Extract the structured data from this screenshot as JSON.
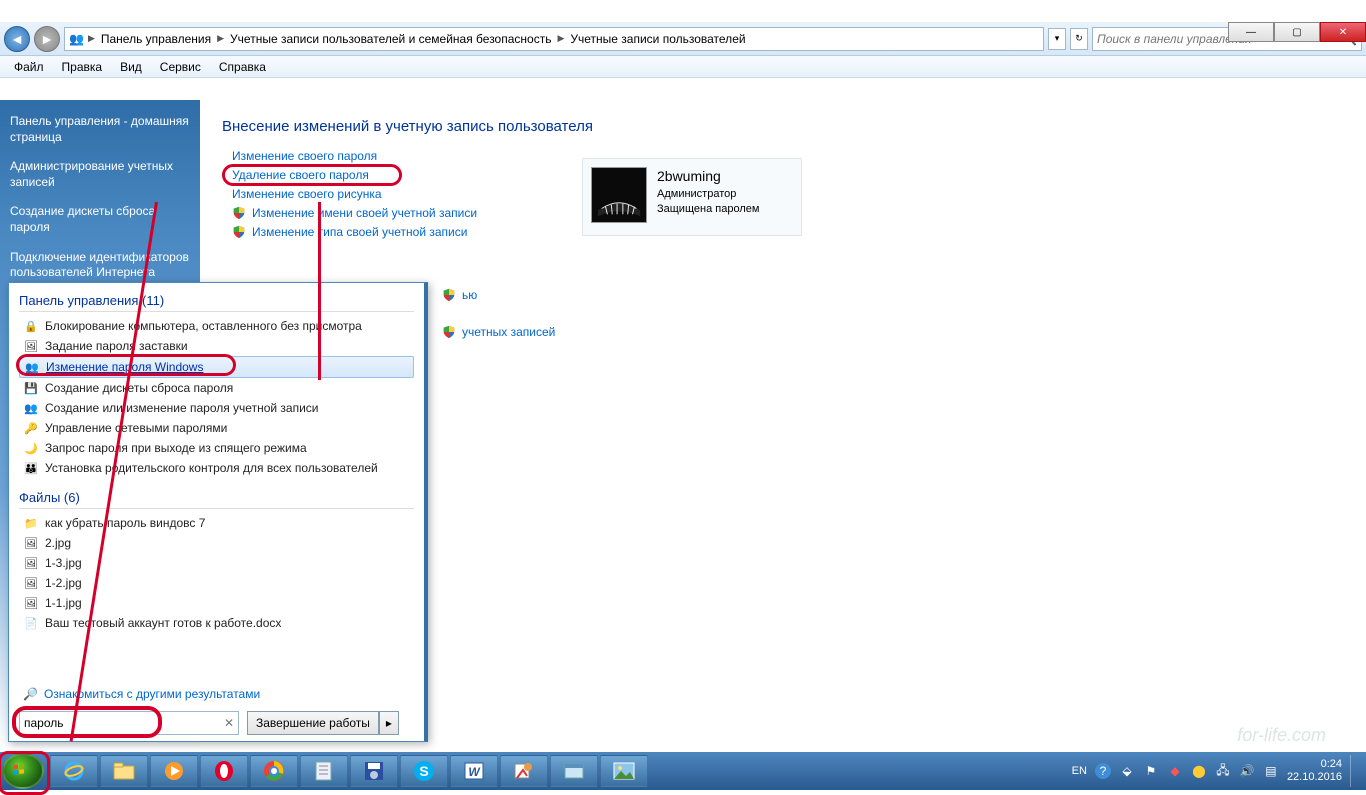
{
  "window": {
    "breadcrumb": [
      "Панель управления",
      "Учетные записи пользователей и семейная безопасность",
      "Учетные записи пользователей"
    ],
    "search_placeholder": "Поиск в панели управления"
  },
  "menubar": [
    "Файл",
    "Правка",
    "Вид",
    "Сервис",
    "Справка"
  ],
  "sidebar": {
    "home": "Панель управления - домашняя страница",
    "links": [
      "Администрирование учетных записей",
      "Создание дискеты сброса пароля",
      "Подключение идентификаторов пользователей Интернета"
    ]
  },
  "main": {
    "title": "Внесение изменений в учетную запись пользователя",
    "links": [
      {
        "text": "Изменение своего пароля",
        "shield": false
      },
      {
        "text": "Удаление своего пароля",
        "shield": false,
        "highlight": true
      },
      {
        "text": "Изменение своего рисунка",
        "shield": false
      },
      {
        "text": "Изменение имени своей учетной записи",
        "shield": true
      },
      {
        "text": "Изменение типа своей учетной записи",
        "shield": true
      },
      {
        "text": "ью",
        "shield": true,
        "partial": true
      },
      {
        "text": "учетных записей",
        "shield": true,
        "partial": true
      }
    ]
  },
  "user": {
    "name": "2bwuming",
    "role": "Администратор",
    "status": "Защищена паролем"
  },
  "startmenu": {
    "group1_title": "Панель управления (11)",
    "group1": [
      "Блокирование компьютера, оставленного без присмотра",
      "Задание пароля заставки",
      "Изменение пароля Windows",
      "Создание дискеты сброса пароля",
      "Создание или изменение пароля учетной записи",
      "Управление сетевыми паролями",
      "Запрос пароля при выходе из спящего режима",
      "Установка родительского контроля для всех пользователей"
    ],
    "group1_selected_index": 2,
    "group2_title": "Файлы (6)",
    "group2": [
      {
        "name": "как убрать пароль виндовс 7",
        "type": "folder"
      },
      {
        "name": "2.jpg",
        "type": "image"
      },
      {
        "name": "1-3.jpg",
        "type": "image"
      },
      {
        "name": "1-2.jpg",
        "type": "image"
      },
      {
        "name": "1-1.jpg",
        "type": "image"
      },
      {
        "name": "Ваш тестовый аккаунт готов к работе.docx",
        "type": "doc"
      }
    ],
    "seemore": "Ознакомиться с другими результатами",
    "search_value": "пароль",
    "shutdown": "Завершение работы"
  },
  "tray": {
    "lang": "EN",
    "time": "0:24",
    "date": "22.10.2016"
  },
  "watermark": "for-life.com"
}
